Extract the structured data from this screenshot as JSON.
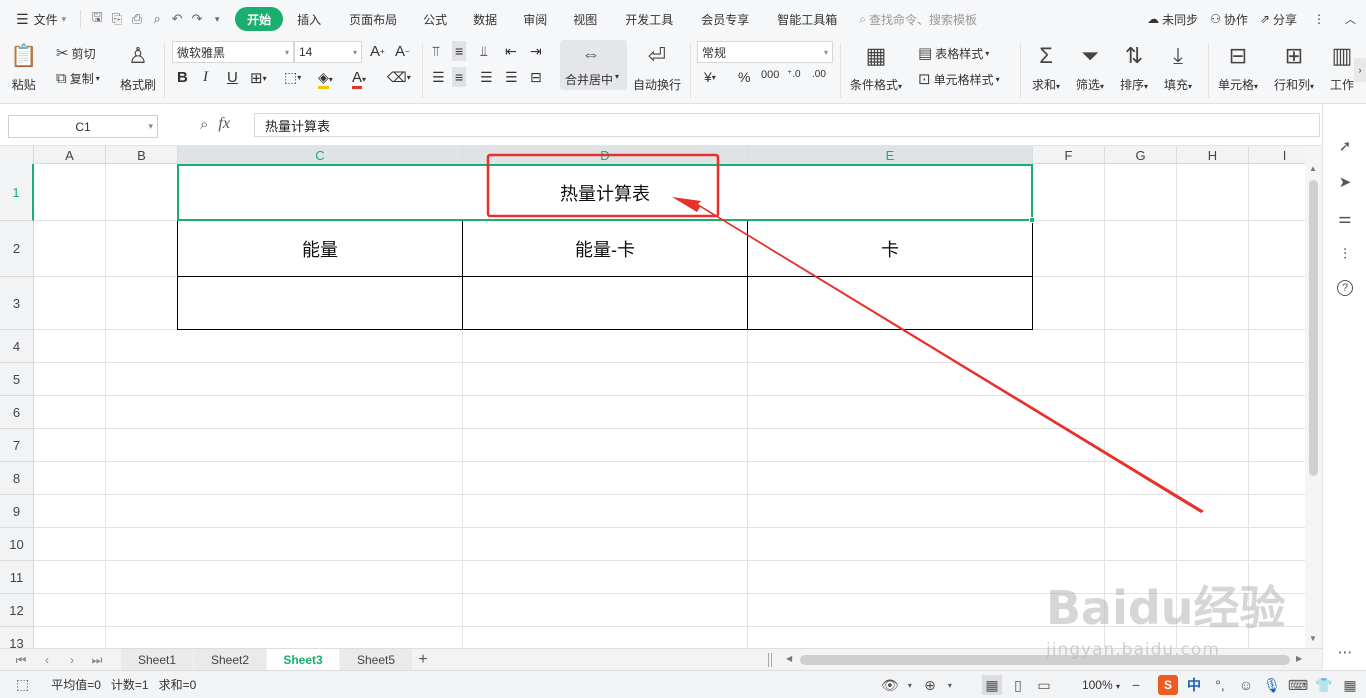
{
  "menu": {
    "file": "文件",
    "tabs": [
      "开始",
      "插入",
      "页面布局",
      "公式",
      "数据",
      "审阅",
      "视图",
      "开发工具",
      "会员专享",
      "智能工具箱"
    ],
    "search_placeholder": "查找命令、搜索模板",
    "sync": "未同步",
    "collab": "协作",
    "share": "分享"
  },
  "ribbon": {
    "paste": "粘贴",
    "cut": "剪切",
    "copy": "复制",
    "format_painter": "格式刷",
    "font_name": "微软雅黑",
    "font_size": "14",
    "merge_center": "合并居中",
    "wrap_text": "自动换行",
    "number_format": "常规",
    "conditional_format": "条件格式",
    "table_style": "表格样式",
    "cell_style": "单元格样式",
    "sum": "求和",
    "filter": "筛选",
    "sort": "排序",
    "fill": "填充",
    "cell": "单元格",
    "row_col": "行和列",
    "work": "工作"
  },
  "formula_bar": {
    "name_box": "C1",
    "fx": "fx",
    "content": "热量计算表"
  },
  "grid": {
    "columns": [
      "A",
      "B",
      "C",
      "D",
      "E",
      "F",
      "G",
      "H",
      "I"
    ],
    "rows": [
      "1",
      "2",
      "3",
      "4",
      "5",
      "6",
      "7",
      "8",
      "9",
      "10",
      "11",
      "12",
      "13"
    ],
    "title": "热量计算表",
    "headers": [
      "能量",
      "能量-卡",
      "卡"
    ]
  },
  "sheets": {
    "tabs": [
      "Sheet1",
      "Sheet2",
      "Sheet3",
      "Sheet5"
    ],
    "active": "Sheet3"
  },
  "status": {
    "average": "平均值=0",
    "count": "计数=1",
    "sum": "求和=0",
    "zoom": "100%",
    "lang": "中"
  },
  "watermark": {
    "brand": "Baidu经验",
    "url": "jingyan.baidu.com"
  },
  "colors": {
    "accent": "#1aae6f",
    "annotation": "#e8312b"
  }
}
